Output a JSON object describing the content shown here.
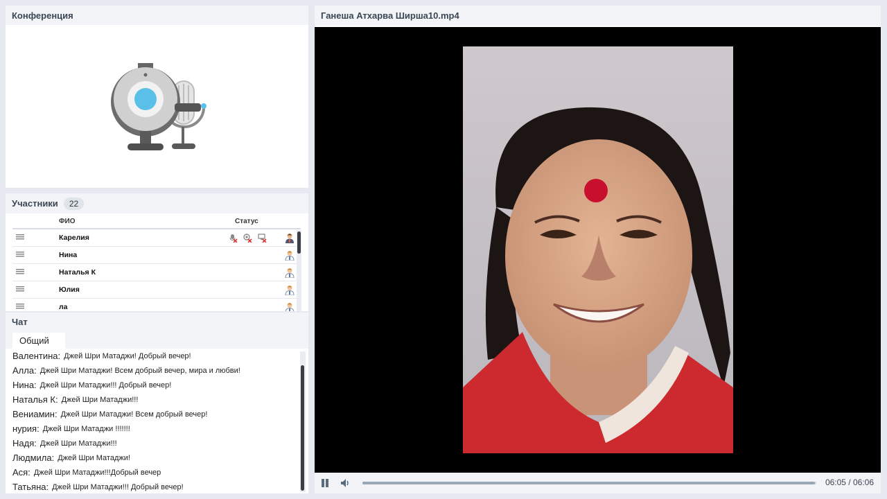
{
  "conference": {
    "title": "Конференция"
  },
  "participants": {
    "title": "Участники",
    "count": "22",
    "headers": {
      "name": "ФИО",
      "status": "Статус"
    },
    "rows": [
      {
        "name": "Карелия"
      },
      {
        "name": "Нина"
      },
      {
        "name": "Наталья К"
      },
      {
        "name": "Юлия"
      },
      {
        "name": "ла"
      }
    ]
  },
  "chat": {
    "title": "Чат",
    "tab": "Общий",
    "messages": [
      {
        "author": "Валентина:",
        "text": "Джей Шри Матаджи! Добрый вечер!"
      },
      {
        "author": "Алла:",
        "text": "Джей Шри Матаджи! Всем добрый вечер, мира и любви!"
      },
      {
        "author": "Нина:",
        "text": "Джей Шри Матаджи!!! Добрый вечер!"
      },
      {
        "author": "Наталья К:",
        "text": "Джей Шри Матаджи!!!"
      },
      {
        "author": "Вениамин:",
        "text": "Джей Шри Матаджи! Всем добрый вечер!"
      },
      {
        "author": "нурия:",
        "text": "Джей Шри Матаджи !!!!!!!"
      },
      {
        "author": "Надя:",
        "text": "Джей Шри Матаджи!!!"
      },
      {
        "author": "Людмила:",
        "text": "Джей Шри Матаджи!"
      },
      {
        "author": "Ася:",
        "text": "Джей Шри Матаджи!!!Добрый вечер"
      },
      {
        "author": "Татьяна:",
        "text": " Джей Шри Матаджи!!! Добрый вечер!"
      }
    ]
  },
  "video": {
    "title": "Ганеша Атхарва Ширша10.mp4",
    "time": "06:05 / 06:06",
    "progress": 0.997
  },
  "colors": {
    "accent": "#3b4654",
    "badge": "#dfe4ea",
    "webcam_lens": "#5bc0e8"
  }
}
